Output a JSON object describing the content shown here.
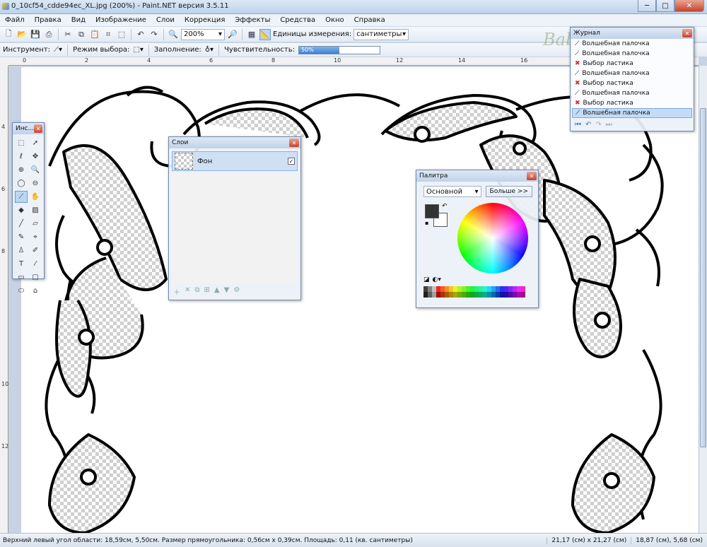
{
  "window": {
    "title": "0_10cf54_cdde94ec_XL.jpg (200%) - Paint.NET версия 3.5.11",
    "minimize": "─",
    "maximize": "□",
    "close": "✕"
  },
  "menu": [
    "Файл",
    "Правка",
    "Вид",
    "Изображение",
    "Слои",
    "Коррекция",
    "Эффекты",
    "Средства",
    "Окно",
    "Справка"
  ],
  "toolbar": {
    "zoom_value": "200%",
    "units_label": "Единицы измерения:",
    "units_value": "сантиметры"
  },
  "options": {
    "tool_label": "Инструмент:",
    "mode_label": "Режим выбора:",
    "fill_label": "Заполнение:",
    "sensitivity_label": "Чувствительность:",
    "sensitivity_value": "50%",
    "sensitivity_fraction": 0.5
  },
  "ruler": {
    "h_ticks": [
      "0",
      "2",
      "4",
      "6",
      "8",
      "10",
      "12",
      "14",
      "16"
    ],
    "v_ticks": [
      "4",
      "6",
      "8",
      "10",
      "12"
    ]
  },
  "tools_panel": {
    "title": "Инс...",
    "close": "✕",
    "icons": [
      "rect-select",
      "move-select",
      "lasso",
      "move",
      "zoom",
      "zoom-out",
      "ellipse",
      "magnify",
      "magic-wand",
      "pan",
      "bucket",
      "gradient",
      "pencil",
      "brush",
      "line",
      "picker",
      "stamp",
      "eraser",
      "text",
      "curve",
      "rect",
      "rounded-rect",
      "ellipse-shape",
      "freeform"
    ]
  },
  "layers_panel": {
    "title": "Слои",
    "close": "✕",
    "layer_name": "Фон",
    "checked": "✓"
  },
  "palette_panel": {
    "title": "Палитра",
    "close": "✕",
    "mode": "Основной",
    "more_button": "Больше >>",
    "primary_color": "#333333",
    "secondary_color": "#ffffff"
  },
  "history_panel": {
    "title": "Журнал",
    "close": "✕",
    "items": [
      {
        "icon": "wand",
        "label": "Волшебная палочка"
      },
      {
        "icon": "wand",
        "label": "Волшебная палочка"
      },
      {
        "icon": "eraser",
        "label": "Выбор ластика"
      },
      {
        "icon": "wand",
        "label": "Волшебная палочка"
      },
      {
        "icon": "eraser",
        "label": "Выбор ластика"
      },
      {
        "icon": "wand",
        "label": "Волшебная палочка"
      },
      {
        "icon": "eraser",
        "label": "Выбор ластика"
      },
      {
        "icon": "wand",
        "label": "Волшебная палочка"
      }
    ]
  },
  "status": {
    "left": "Верхний левый угол области: 18,59см, 5,50см. Размер прямоугольника: 0,56см x 0,39см. Площадь: 0,11 (кв. сантиметры)",
    "image_size": "21,17 (см) x 21,27 (см)",
    "cursor_pos": "18,87 (см), 5,68 (см)"
  },
  "watermark": "BabyMama.ru",
  "colors": {
    "accent": "#3e80cf",
    "panel_border": "#6f8aae",
    "canvas_bg": "#ffffff",
    "lace_stroke": "#000000"
  }
}
